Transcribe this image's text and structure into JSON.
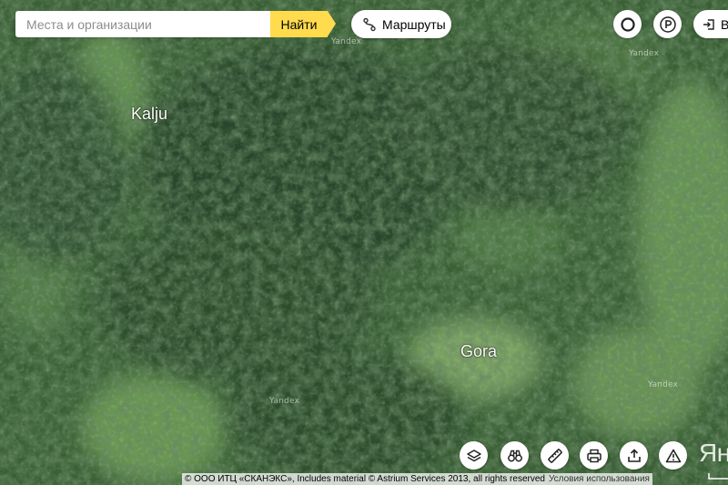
{
  "search": {
    "placeholder": "Места и организации",
    "value": "",
    "button_label": "Найти"
  },
  "routes": {
    "label": "Маршруты"
  },
  "top_right": {
    "login_label": "В",
    "buttons": [
      "alice-icon",
      "parking-icon"
    ]
  },
  "map": {
    "type": "satellite",
    "places": [
      {
        "name": "Kalju"
      },
      {
        "name": "Gora"
      }
    ],
    "watermark": "Yandex"
  },
  "tools": [
    "layers-icon",
    "panorama-icon",
    "ruler-icon",
    "print-icon",
    "share-icon",
    "report-error-icon"
  ],
  "footer": {
    "copyright": "© ООО ИТЦ «СКАНЭКС», Includes material © Astrium Services 2013, all rights reserved",
    "terms_link": "Условия использования",
    "logo_text": "Янд"
  },
  "colors": {
    "accent": "#ffdb4d",
    "forest_dark": "#2f4f2c",
    "forest_mid": "#3d6236",
    "meadow": "#5e8c4d"
  }
}
